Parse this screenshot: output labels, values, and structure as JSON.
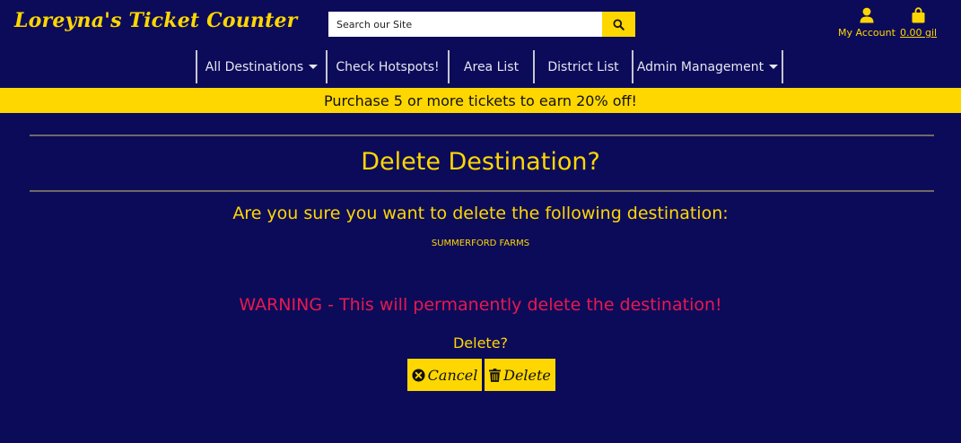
{
  "header": {
    "brand": "Loreyna's Ticket Counter",
    "search_placeholder": "Search our Site",
    "account_label": "My Account",
    "cart_label": "0.00 gil"
  },
  "nav": {
    "items": [
      {
        "label": "All Destinations",
        "dropdown": true
      },
      {
        "label": "Check Hotspots!",
        "dropdown": false
      },
      {
        "label": "Area List",
        "dropdown": false
      },
      {
        "label": "District List",
        "dropdown": false
      },
      {
        "label": "Admin Management",
        "dropdown": true
      }
    ]
  },
  "promo": "Purchase 5 or more tickets to earn 20% off!",
  "main": {
    "title": "Delete Destination?",
    "question": "Are you sure you want to delete the following destination:",
    "destination": "SUMMERFORD FARMS",
    "warning": "WARNING - This will permanently delete the destination!",
    "confirm_label": "Delete?",
    "cancel_label": "Cancel",
    "delete_label": "Delete"
  },
  "colors": {
    "background": "#0c0b5a",
    "accent": "#ffd700",
    "warning": "#e8194e"
  },
  "icons": [
    "search-icon",
    "user-icon",
    "shopping-bag-icon",
    "times-circle-icon",
    "trash-icon"
  ]
}
